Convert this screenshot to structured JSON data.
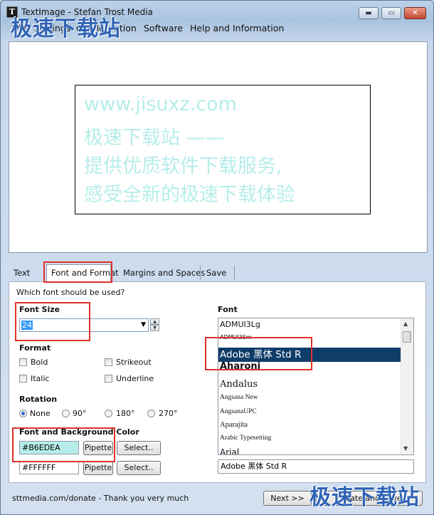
{
  "window": {
    "title": "TextImage - Stefan Trost Media",
    "controls": {
      "minimize": "▬",
      "maximize": "▭",
      "close": "✕"
    }
  },
  "app_icon": "T",
  "menu": [
    "File",
    "Settings",
    "Configuration",
    "Software",
    "Help and Information"
  ],
  "watermark": {
    "text": "极速下载站"
  },
  "preview": {
    "text_color": "#B6EDEA",
    "background_color": "#FFFFFF",
    "lines": [
      "www.jisuxz.com",
      "极速下载站 ——",
      "提供优质软件下载服务,",
      "感受全新的极速下载体验"
    ]
  },
  "tabs": [
    {
      "label": "Text",
      "active": false
    },
    {
      "label": "Font and Format",
      "active": true
    },
    {
      "label": "Margins and Spaces",
      "active": false
    },
    {
      "label": "Save",
      "active": false
    }
  ],
  "panel": {
    "question": "Which font should be used?",
    "font_size": {
      "label": "Font Size",
      "value": "24"
    },
    "format": {
      "label": "Format",
      "options": [
        {
          "label": "Bold",
          "checked": false
        },
        {
          "label": "Strikeout",
          "checked": false
        },
        {
          "label": "Italic",
          "checked": false
        },
        {
          "label": "Underline",
          "checked": false
        }
      ]
    },
    "rotation": {
      "label": "Rotation",
      "options": [
        {
          "label": "None",
          "checked": true
        },
        {
          "label": "90°",
          "checked": false
        },
        {
          "label": "180°",
          "checked": false
        },
        {
          "label": "270°",
          "checked": false
        }
      ]
    },
    "colors": {
      "label": "Font and Background Color",
      "font_color": "#B6EDEA",
      "background_color": "#FFFFFF",
      "pipette_label": "Pipette",
      "select_label": "Select.."
    },
    "font": {
      "label": "Font",
      "items": [
        "ADMUI3Lg",
        "ADMUI3Sm",
        "Adobe 黑体 Std R",
        "Aharoni",
        "Andalus",
        "Angsana New",
        "AngsanaUPC",
        "Aparajita",
        "Arabic Typesetting",
        "Arial"
      ],
      "selected": "Adobe 黑体 Std R",
      "input_value": "Adobe 黑体 Std R"
    }
  },
  "footer": {
    "status": "sttmedia.com/donate - Thank you very much",
    "next_label": "Next >>",
    "create_label": "Create and Save"
  }
}
